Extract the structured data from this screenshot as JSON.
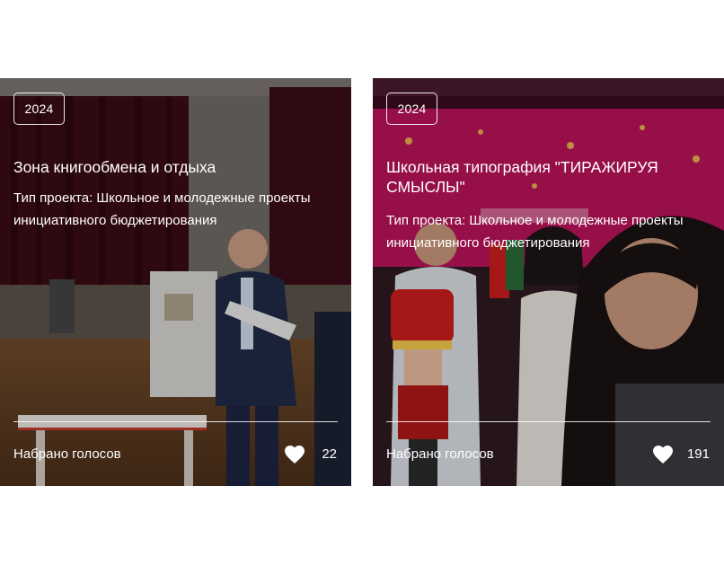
{
  "cards": [
    {
      "year": "2024",
      "title": "Зона книгообмена и отдыха",
      "type_text": "Тип проекта: Школьное и молодежные проекты инициативного бюджетирования",
      "votes_label": "Набрано голосов",
      "votes_count": "22",
      "icon": "heart-icon"
    },
    {
      "year": "2024",
      "title": "Школьная типография \"ТИРАЖИРУЯ СМЫСЛЫ\"",
      "type_text": "Тип проекта: Школьное и молодежные проекты инициативного бюджетирования",
      "votes_label": "Набрано голосов",
      "votes_count": "191",
      "icon": "heart-icon"
    }
  ],
  "colors": {
    "overlay_text": "#ffffff",
    "page_background": "#ffffff"
  }
}
